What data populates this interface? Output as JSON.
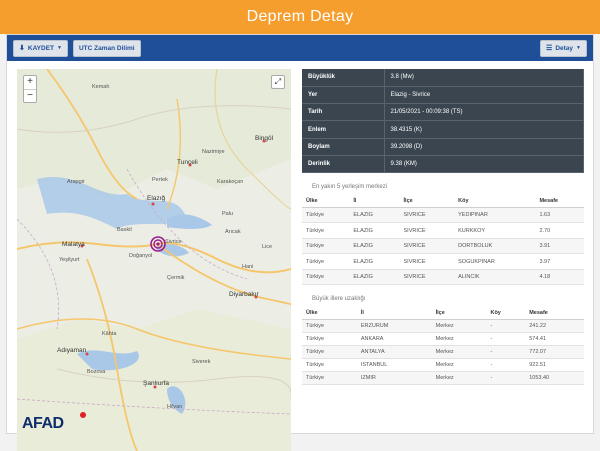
{
  "header": {
    "title": "Deprem Detay"
  },
  "toolbar": {
    "save_label": "KAYDET",
    "utc_label": "UTC Zaman Dilimi",
    "detail_label": "Detay"
  },
  "map": {
    "logo": "AFAD",
    "labels": [
      {
        "text": "Tunceli"
      },
      {
        "text": "Elazığ"
      },
      {
        "text": "Malatya"
      },
      {
        "text": "Doğanyol"
      },
      {
        "text": "Çermik"
      },
      {
        "text": "Diyarbakır"
      },
      {
        "text": "Adıyaman"
      },
      {
        "text": "Şanlıurfa"
      },
      {
        "text": "Bozova"
      },
      {
        "text": "Pertek"
      },
      {
        "text": "Nazimiye"
      },
      {
        "text": "Bingöl"
      },
      {
        "text": "Karakoçan"
      },
      {
        "text": "Palu"
      },
      {
        "text": "Arıcak"
      },
      {
        "text": "Hani"
      },
      {
        "text": "Lice"
      },
      {
        "text": "Kâhta"
      },
      {
        "text": "Siverek"
      },
      {
        "text": "Baskil"
      },
      {
        "text": "Yeşilyurt"
      },
      {
        "text": "Arapgir"
      },
      {
        "text": "Kemah"
      },
      {
        "text": "Sivrice"
      },
      {
        "text": "Hilvan"
      }
    ]
  },
  "info": [
    {
      "key": "Büyüklük",
      "value": "3.8 (Mw)"
    },
    {
      "key": "Yer",
      "value": "Elazig - Sivrice"
    },
    {
      "key": "Tarih",
      "value": "21/05/2021 - 00:09:38 (TS)"
    },
    {
      "key": "Enlem",
      "value": "38.4315 (K)"
    },
    {
      "key": "Boylam",
      "value": "39.2098 (D)"
    },
    {
      "key": "Derinlik",
      "value": "9.38 (KM)"
    }
  ],
  "nearby": {
    "title": "En yakın 5 yerleşim merkezi",
    "headers": [
      "Ülke",
      "İl",
      "İlçe",
      "Köy",
      "Mesafe"
    ],
    "rows": [
      [
        "Türkiye",
        "ELAZIG",
        "SIVRICE",
        "YEDIPINAR",
        "1.63"
      ],
      [
        "Türkiye",
        "ELAZIG",
        "SIVRICE",
        "KURKKOY",
        "2.70"
      ],
      [
        "Türkiye",
        "ELAZIG",
        "SIVRICE",
        "DORTBOLUK",
        "3.91"
      ],
      [
        "Türkiye",
        "ELAZIG",
        "SIVRICE",
        "SOGUKPINAR",
        "3.97"
      ],
      [
        "Türkiye",
        "ELAZIG",
        "SIVRICE",
        "ALINCIK",
        "4.18"
      ]
    ]
  },
  "cities": {
    "title": "Büyük illere uzaklığı",
    "headers": [
      "Ülke",
      "İl",
      "İlçe",
      "Köy",
      "Mesafe"
    ],
    "rows": [
      [
        "Türkiye",
        "ERZURUM",
        "Merkez",
        "-",
        "241.22"
      ],
      [
        "Türkiye",
        "ANKARA",
        "Merkez",
        "-",
        "574.41"
      ],
      [
        "Türkiye",
        "ANTALYA",
        "Merkez",
        "-",
        "772.07"
      ],
      [
        "Türkiye",
        "ISTANBUL",
        "Merkez",
        "-",
        "922.51"
      ],
      [
        "Türkiye",
        "IZMIR",
        "Merkez",
        "-",
        "1053.40"
      ]
    ]
  }
}
